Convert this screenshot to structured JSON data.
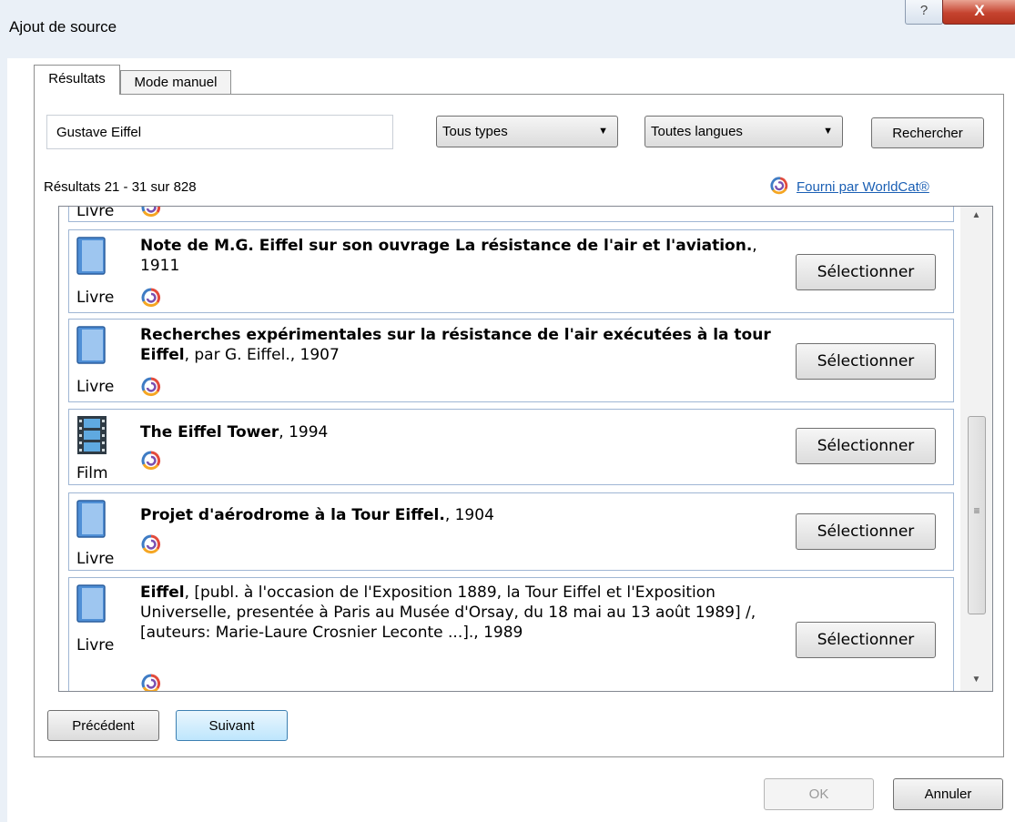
{
  "window": {
    "title": "Ajout de source",
    "help_glyph": "?",
    "close_glyph": "X"
  },
  "tabs": [
    {
      "label": "Résultats",
      "active": true
    },
    {
      "label": "Mode manuel",
      "active": false
    }
  ],
  "search": {
    "query": "Gustave Eiffel",
    "type_filter": "Tous types",
    "language_filter": "Toutes langues",
    "search_label": "Rechercher"
  },
  "results": {
    "summary": "Résultats 21 - 31 sur 828",
    "provider_label": "Fourni par WorldCat®",
    "select_label": "Sélectionner",
    "partial_item_label": "Livre",
    "items": [
      {
        "title_bold": "Note de M.G. Eiffel sur son ouvrage La résistance de l'air et l'aviation.",
        "title_rest": ", 1911",
        "type": "Livre"
      },
      {
        "title_bold": "Recherches expérimentales sur la résistance de l'air exécutées à la tour Eiffel",
        "title_rest": ", par G. Eiffel., 1907",
        "type": "Livre"
      },
      {
        "title_bold": "The Eiffel Tower",
        "title_rest": ", 1994",
        "type": "Film"
      },
      {
        "title_bold": "Projet d'aérodrome à la Tour Eiffel.",
        "title_rest": ", 1904",
        "type": "Livre"
      },
      {
        "title_bold": "Eiffel",
        "title_rest": ", [publ. à l'occasion de l'Exposition 1889, la Tour Eiffel et l'Exposition Universelle, presentée à Paris au Musée d'Orsay, du 18 mai au 13 août 1989] /, [auteurs: Marie-Laure Crosnier Leconte ...]., 1989",
        "type": "Livre"
      }
    ]
  },
  "pager": {
    "previous": "Précédent",
    "next": "Suivant"
  },
  "dialog_buttons": {
    "ok": "OK",
    "cancel": "Annuler"
  },
  "colors": {
    "link": "#1a5fb4",
    "item_border": "#9fb6d4",
    "book_blue": "#4f8fd6"
  }
}
